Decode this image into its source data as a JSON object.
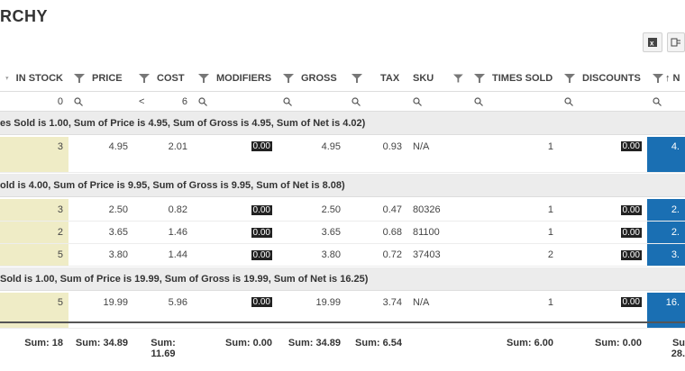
{
  "title": "RCHY",
  "toolbar": {
    "export_icon": "excel-export-icon",
    "columns_icon": "columns-icon"
  },
  "headers": {
    "in_stock": "IN STOCK",
    "price": "PRICE",
    "cost": "COST",
    "modifiers": "MODIFIERS",
    "gross": "GROSS",
    "tax": "TAX",
    "sku": "SKU",
    "times_sold": "TIMES SOLD",
    "discounts": "DISCOUNTS",
    "sorted": "↑ N"
  },
  "filters": {
    "in_stock": "0",
    "cost_op": "<",
    "cost": "6"
  },
  "groups": [
    {
      "label": "es Sold is 1.00, Sum of Price is 4.95, Sum of Gross is 4.95, Sum of Net is 4.02)",
      "rows": [
        {
          "in_stock": "3",
          "price": "4.95",
          "cost": "2.01",
          "modifiers": "0.00",
          "gross": "4.95",
          "tax": "0.93",
          "sku": "N/A",
          "times_sold": "1",
          "discounts": "0.00",
          "net": "4."
        }
      ]
    },
    {
      "label": "old is 4.00, Sum of Price is 9.95, Sum of Gross is 9.95, Sum of Net is 8.08)",
      "rows": [
        {
          "in_stock": "3",
          "price": "2.50",
          "cost": "0.82",
          "modifiers": "0.00",
          "gross": "2.50",
          "tax": "0.47",
          "sku": "80326",
          "times_sold": "1",
          "discounts": "0.00",
          "net": "2."
        },
        {
          "in_stock": "2",
          "price": "3.65",
          "cost": "1.46",
          "modifiers": "0.00",
          "gross": "3.65",
          "tax": "0.68",
          "sku": "81100",
          "times_sold": "1",
          "discounts": "0.00",
          "net": "2."
        },
        {
          "in_stock": "5",
          "price": "3.80",
          "cost": "1.44",
          "modifiers": "0.00",
          "gross": "3.80",
          "tax": "0.72",
          "sku": "37403",
          "times_sold": "2",
          "discounts": "0.00",
          "net": "3."
        }
      ]
    },
    {
      "label": "Sold is 1.00, Sum of Price is 19.99, Sum of Gross is 19.99, Sum of Net is 16.25)",
      "rows": [
        {
          "in_stock": "5",
          "price": "19.99",
          "cost": "5.96",
          "modifiers": "0.00",
          "gross": "19.99",
          "tax": "3.74",
          "sku": "N/A",
          "times_sold": "1",
          "discounts": "0.00",
          "net": "16."
        }
      ]
    }
  ],
  "footer": {
    "in_stock": "Sum: 18",
    "price": "Sum: 34.89",
    "cost_1": "Sum:",
    "cost_2": "11.69",
    "modifiers": "Sum: 0.00",
    "gross": "Sum: 34.89",
    "tax": "Sum: 6.54",
    "times_sold": "Sum: 6.00",
    "discounts": "Sum: 0.00",
    "net_1": "Su",
    "net_2": "28."
  },
  "colors": {
    "highlight_yellow": "#efecc6",
    "highlight_blue": "#1a6fb3",
    "group_bg": "#ececec"
  }
}
